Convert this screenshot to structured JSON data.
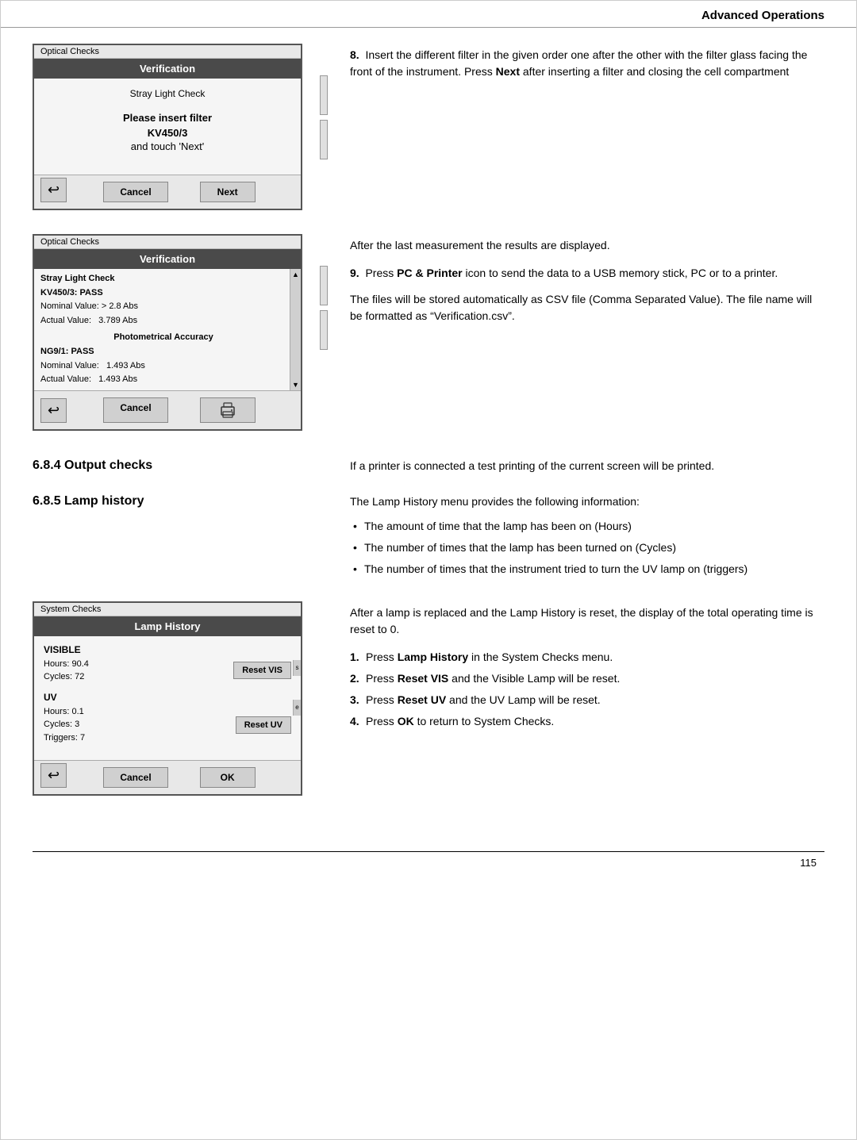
{
  "header": {
    "title": "Advanced Operations"
  },
  "section1": {
    "screen1": {
      "outer_label": "Optical Checks",
      "title": "Verification",
      "stray_light": "Stray Light Check",
      "insert_msg": "Please insert filter",
      "filter_code": "KV450/3",
      "touch_msg": "and touch 'Next'",
      "cancel_btn": "Cancel",
      "next_btn": "Next"
    },
    "step8_text": "Insert the different filter in the given order one after the other with the filter glass facing the front of the instrument. Press",
    "step8_bold": "Next",
    "step8_after": "after inserting a filter and closing the cell compartment"
  },
  "section2": {
    "screen2": {
      "outer_label": "Optical Checks",
      "title": "Verification",
      "results": [
        {
          "label": "Stray Light Check",
          "bold": true
        },
        {
          "label": "KV450/3: PASS",
          "bold": true
        },
        {
          "label": "Nominal Value: > 2.8 Abs",
          "bold": false
        },
        {
          "label": "Actual Value:   3.789 Abs",
          "bold": false
        },
        {
          "label": "Photometrical Accuracy",
          "bold": true,
          "center": true
        },
        {
          "label": "NG9/1: PASS",
          "bold": true
        },
        {
          "label": "Nominal Value:   1.493 Abs",
          "bold": false
        },
        {
          "label": "Actual Value:   1.493 Abs",
          "bold": false
        }
      ],
      "cancel_btn": "Cancel"
    },
    "after_text": "After the last measurement the results are displayed.",
    "step9_pre": "Press",
    "step9_bold": "PC & Printer",
    "step9_after": "icon to send the data to a USB memory stick, PC or to a printer.",
    "files_text": "The files will be stored automatically as CSV file (Comma Separated Value). The file name will be formatted as “Verification.csv”."
  },
  "section3": {
    "heading": "6.8.4  Output checks",
    "text": "If a printer is connected a test printing of the current screen will be printed."
  },
  "section4": {
    "heading": "6.8.5  Lamp history",
    "intro": "The Lamp History menu provides the following information:",
    "bullets": [
      "The amount of time that the lamp has been on (Hours)",
      "The number of times that the lamp has been turned on (Cycles)",
      "The number of times that the instrument tried to turn the UV lamp on (triggers)"
    ],
    "screen": {
      "outer_label": "System Checks",
      "title": "Lamp History",
      "visible_label": "VISIBLE",
      "hours_vis": "Hours: 90.4",
      "reset_vis_btn": "Reset VIS",
      "cycles_vis": "Cycles: 72",
      "uv_label": "UV",
      "hours_uv": "Hours: 0.1",
      "reset_uv_btn": "Reset UV",
      "cycles_uv": "Cycles: 3",
      "triggers_uv": "Triggers: 7",
      "cancel_btn": "Cancel",
      "ok_btn": "OK"
    },
    "after_text": "After a lamp is replaced and the Lamp History is reset, the display of the total operating time is reset to 0.",
    "steps": [
      {
        "num": "1.",
        "pre": "Press",
        "bold": "Lamp History",
        "after": "in the System Checks menu."
      },
      {
        "num": "2.",
        "pre": "Press",
        "bold": "Reset VIS",
        "after": "and the Visible Lamp will be reset."
      },
      {
        "num": "3.",
        "pre": "Press",
        "bold": "Reset UV",
        "after": "and the UV Lamp will be reset."
      },
      {
        "num": "4.",
        "pre": "Press",
        "bold": "OK",
        "after": "to return to System Checks."
      }
    ]
  },
  "footer": {
    "page_number": "115"
  }
}
